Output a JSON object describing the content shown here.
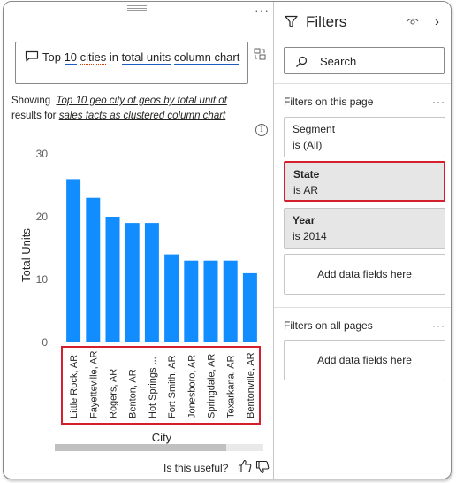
{
  "qa": {
    "more_label": "···",
    "question_parts": [
      {
        "text": "Top ",
        "style": "plain"
      },
      {
        "text": "10",
        "style": "uline"
      },
      {
        "text": " ",
        "style": "plain"
      },
      {
        "text": "cities",
        "style": "dotted"
      },
      {
        "text": " in ",
        "style": "plain"
      },
      {
        "text": "total units",
        "style": "uline"
      },
      {
        "text": " ",
        "style": "plain"
      },
      {
        "text": "column chart",
        "style": "uline"
      }
    ],
    "showing_prefix": "Showing ",
    "showing_phrase": "Top 10 geo city of geos by total unit of",
    "showing_mid": "results for ",
    "showing_source": "sales facts as clustered column chart",
    "info_glyph": "i",
    "useful_text": "Is this useful?"
  },
  "chart_data": {
    "type": "bar",
    "categories": [
      "Little Rock, AR",
      "Fayetteville, AR",
      "Rogers, AR",
      "Benton, AR",
      "Hot Springs ...",
      "Fort Smith, AR",
      "Jonesboro, AR",
      "Springdale, AR",
      "Texarkana, AR",
      "Bentonville, AR"
    ],
    "values": [
      26,
      23,
      20,
      19,
      19,
      14,
      13,
      13,
      13,
      11
    ],
    "xlabel": "City",
    "ylabel": "Total Units",
    "ylim": [
      0,
      30
    ],
    "yticks": [
      "0",
      "10",
      "20",
      "30"
    ],
    "grid": false,
    "bar_color": "#118dff",
    "highlight_color": "#d4202c"
  },
  "filters": {
    "title": "Filters",
    "search_placeholder": "Search",
    "on_this_page_label": "Filters on this page",
    "on_all_pages_label": "Filters on all pages",
    "more_label": "···",
    "chevron": "›",
    "cards": [
      {
        "name": "Segment",
        "value": "is (All)"
      },
      {
        "name": "State",
        "value": "is AR"
      },
      {
        "name": "Year",
        "value": "is 2014"
      }
    ],
    "add_fields_label": "Add data fields here"
  }
}
